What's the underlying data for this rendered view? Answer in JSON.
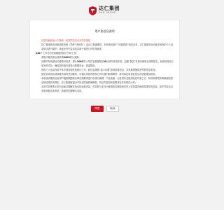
{
  "header": {
    "logo_cn": "达仁集团",
    "logo_en": "DAR GROUP"
  },
  "card": {
    "title": "用户协议及说明",
    "notice": "请您仔细阅读以下条款，如您同意请点击同意按钮",
    "paragraphs": [
      "达仁集团在线问卷调查系统（简称“本系统”）由达仁集团提供，本系统仅用于“问卷调查”相关业务，达仁集团将对问卷调查中填写的个人信息进行保护，不会将信息用于调查以外的用途或提供给第三方。",
      "140",
      "本问卷调查约需填写20分钟。",
      "2000",
      "30"
    ],
    "p1": "达仁集团在线问卷调查系统（简称“本系统”）由达仁集团提供，本系统仅用于“问卷调查”相关业务，达仁集团将对问卷中填写的个人信息依法进行保护，未经允许不会将信息用于调查以外的用途或",
    "p1_num": "140",
    "p1_tail": "个工作日内完成数据的统计分析工作。",
    "p2_pre": "调查问卷完成后将获得",
    "p2_num": "2000",
    "p2_tail": "积分奖励。",
    "p3_pre": "问卷中所有题目均需填写完成，预计",
    "p3_num": "2000",
    "p3_mid": "字以内的主观题需在",
    "p3_num2": "30",
    "p3_tail": "分钟内完成作答，如遇“提交”失败请刷新后重新提交，系统将保存已填写的内容，确保您的填写体验与数据安全，感谢配合。",
    "p4": "您的个人信息仅用于本次调查相关的统计工作，我们会按照“最小必要”原则收集信息，并采取措施保护您的信息安全。",
    "p5": "如您对本协议或调查内容有任何疑问，可通过系统内联系方式与我们取得联系，我们将在收到反馈后尽快处理并回复。",
    "p6": "本系统收集的信息将严格按照国家法律法规要求进行存储与管理，不会泄露、出售或非法提供给任何第三方，除非获得您的明确授权或法律法规另有规定，达仁集团保留对本协议的最终解释权，协议内容如有变更将在本系统内公布。",
    "p7": "点击同意即表示您已阅读并理解本协议的全部内容，同意参与本次问卷调查并授权我们在上述范围内使用您提供的信息，如不同意请点击取消退出本系统，感谢您的理解与支持。"
  },
  "buttons": {
    "agree": "同意",
    "cancel": "取消"
  },
  "colors": {
    "brand_red": "#c9151e",
    "notice_red": "#d9534f"
  }
}
